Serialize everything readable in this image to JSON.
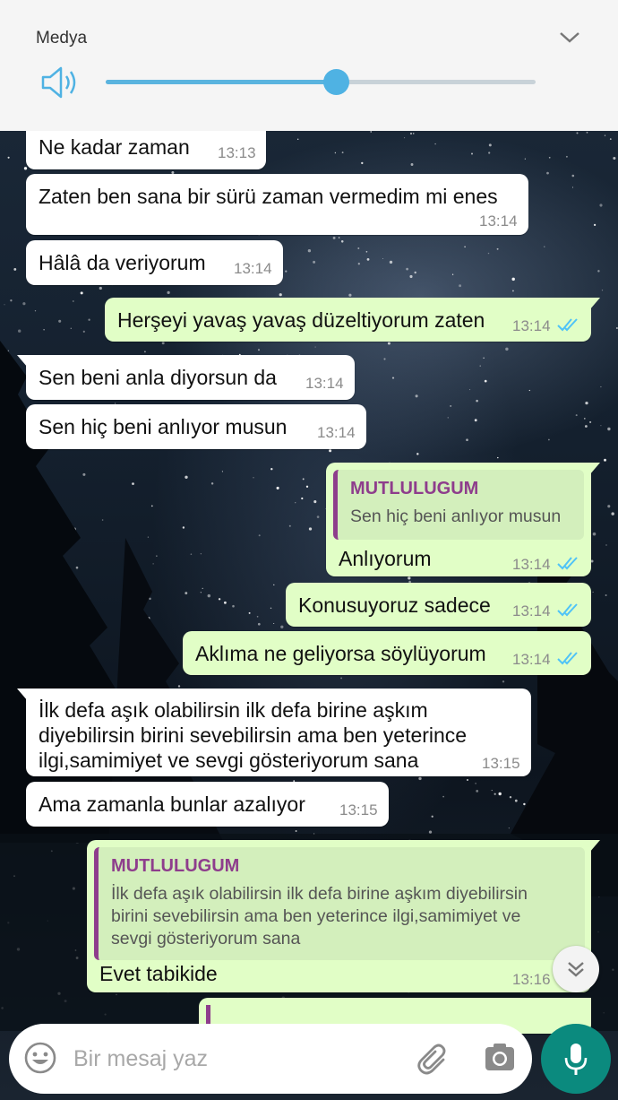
{
  "volume": {
    "title": "Medya",
    "level_fraction": 0.535,
    "accent_color": "#4fb2e3",
    "icons": {
      "speaker": "speaker-icon",
      "collapse": "chevron-down-icon"
    }
  },
  "messages": [
    {
      "direction": "incoming",
      "text": "Ne kadar zaman",
      "time": "13:13"
    },
    {
      "direction": "incoming",
      "text": "Zaten ben sana bir sürü zaman vermedim mi enes",
      "time": "13:14"
    },
    {
      "direction": "incoming",
      "text": "Hâlâ da veriyorum",
      "time": "13:14"
    },
    {
      "direction": "outgoing",
      "text": "Herşeyi yavaş yavaş düzeltiyorum zaten",
      "time": "13:14",
      "read": true
    },
    {
      "direction": "incoming",
      "text": "Sen beni anla diyorsun da",
      "time": "13:14"
    },
    {
      "direction": "incoming",
      "text": "Sen hiç beni anlıyor musun",
      "time": "13:14"
    },
    {
      "direction": "outgoing",
      "text": "Anlıyorum",
      "time": "13:14",
      "read": true,
      "quote": {
        "author": "MUTLULUGUM",
        "text": "Sen hiç beni anlıyor musun"
      }
    },
    {
      "direction": "outgoing",
      "text": "Konusuyoruz sadece",
      "time": "13:14",
      "read": true
    },
    {
      "direction": "outgoing",
      "text": "Aklıma ne geliyorsa söylüyorum",
      "time": "13:14",
      "read": true
    },
    {
      "direction": "incoming",
      "text": "İlk defa aşık olabilirsin ilk defa birine aşkım\ndiyebilirsin birini sevebilirsin ama ben yeterince\nilgi,samimiyet ve sevgi gösteriyorum sana",
      "time": "13:15"
    },
    {
      "direction": "incoming",
      "text": "Ama zamanla bunlar azalıyor",
      "time": "13:15"
    },
    {
      "direction": "outgoing",
      "text": "Evet tabikide",
      "time": "13:16",
      "quote": {
        "author": "MUTLULUGUM",
        "text": "İlk defa aşık olabilirsin ilk defa birine aşkım diyebilirsin\nbirini sevebilirsin ama ben yeterince ilgi,samimiyet ve\nsevgi gösteriyorum sana"
      }
    }
  ],
  "colors": {
    "incoming_bubble": "#ffffff",
    "outgoing_bubble": "#e1fec6",
    "quote_author": "#8e3d8c",
    "read_ticks": "#4fc3f7",
    "mic_button": "#0b8a7e"
  },
  "composer": {
    "placeholder": "Bir mesaj yaz",
    "icons": {
      "emoji": "emoji-icon",
      "attach": "paperclip-icon",
      "camera": "camera-icon",
      "send": "microphone-icon"
    }
  },
  "scroll_button_icon": "double-chevron-down-icon"
}
